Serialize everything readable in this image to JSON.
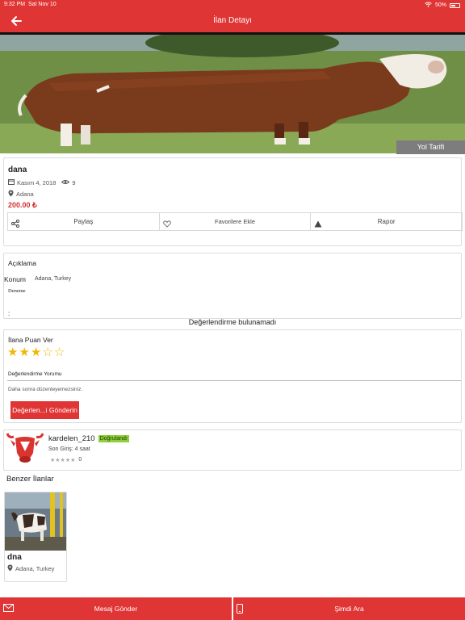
{
  "status_bar": {
    "time": "9:32 PM",
    "date": "Sat Nov 10",
    "battery": "50%"
  },
  "nav": {
    "title": "İlan Detayı"
  },
  "hero": {
    "directions_label": "Yol Tarifi"
  },
  "listing": {
    "title": "dana",
    "date": "Kasım 4, 2018",
    "views": "9",
    "location": "Adana",
    "price": "200.00 ₺",
    "actions": {
      "share": "Paylaş",
      "favorite": "Favorilere Ekle",
      "report": "Rapor"
    }
  },
  "description": {
    "heading": "Açıklama",
    "location_label": "Konum",
    "location_value": "Adana, Turkey",
    "text": "Deneme",
    "extra": ":"
  },
  "reviews": {
    "empty_message": "Değerlendirme bulunamadı"
  },
  "rating_form": {
    "title": "İlana Puan Ver",
    "rating": 3,
    "max_rating": 5,
    "comment_label": "Değerlendirme Yorumu",
    "note": "Daha sonra düzenleyemezsiniz.",
    "submit_label": "Değerlen...i Gönderin"
  },
  "seller": {
    "username": "kardelen_210",
    "badge": "Doğrulandı",
    "last_login": "Son Giriş: 4 saat",
    "rating_stars": "★★★★★",
    "rating_count": "0"
  },
  "similar": {
    "heading": "Benzer İlanlar",
    "items": [
      {
        "title": "dna",
        "location": "Adana, Turkey"
      }
    ]
  },
  "bottom_bar": {
    "message_label": "Mesaj Gönder",
    "call_label": "Şimdi Ara"
  },
  "colors": {
    "primary": "#e03535",
    "price": "#d32f2f",
    "star": "#f2b705",
    "verified": "#8fcf3c"
  }
}
